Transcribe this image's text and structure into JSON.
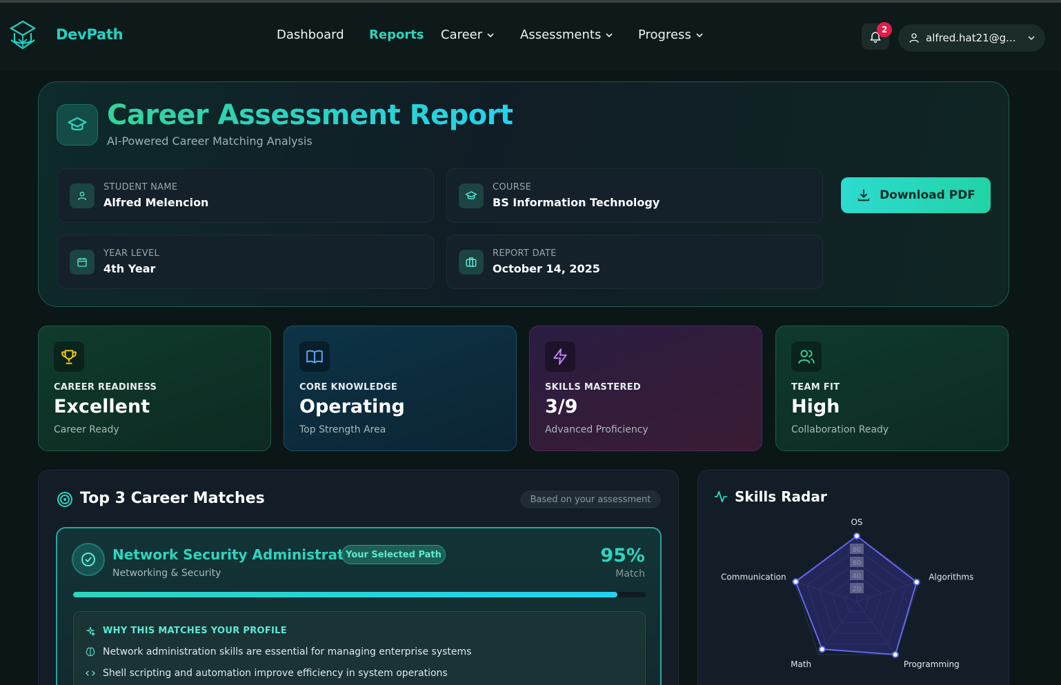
{
  "nav": {
    "brand": "DevPath",
    "links": [
      {
        "label": "Dashboard",
        "active": false,
        "dropdown": false
      },
      {
        "label": "Reports",
        "active": true,
        "dropdown": false
      },
      {
        "label": "Career",
        "active": false,
        "dropdown": true
      },
      {
        "label": "Assessments",
        "active": false,
        "dropdown": true
      },
      {
        "label": "Progress",
        "active": false,
        "dropdown": true
      }
    ],
    "notification_count": "2",
    "user_email": "alfred.hat21@g..."
  },
  "report": {
    "title": "Career Assessment Report",
    "subtitle": "AI-Powered Career Matching Analysis",
    "student_label": "STUDENT NAME",
    "student_value": "Alfred Melencion",
    "course_label": "COURSE",
    "course_value": "BS Information Technology",
    "year_label": "YEAR LEVEL",
    "year_value": "4th Year",
    "date_label": "REPORT DATE",
    "date_value": "October 14, 2025",
    "download_label": "Download PDF"
  },
  "stats": [
    {
      "label": "CAREER READINESS",
      "value": "Excellent",
      "desc": "Career Ready",
      "icon": "trophy-icon"
    },
    {
      "label": "CORE KNOWLEDGE",
      "value": "Operating",
      "desc": "Top Strength Area",
      "icon": "book-icon"
    },
    {
      "label": "SKILLS MASTERED",
      "value": "3/9",
      "desc": "Advanced Proficiency",
      "icon": "lightning-icon"
    },
    {
      "label": "TEAM FIT",
      "value": "High",
      "desc": "Collaboration Ready",
      "icon": "users-icon"
    }
  ],
  "matches": {
    "title": "Top 3 Career Matches",
    "chip": "Based on your assessment",
    "top": {
      "title": "Network Security Administrator",
      "badge": "Your Selected Path",
      "category": "Networking & Security",
      "percent": "95%",
      "percent_label": "Match",
      "progress": 0.95,
      "why_title": "WHY THIS MATCHES YOUR PROFILE",
      "reasons": [
        {
          "icon": "brain-icon",
          "text": "Network administration skills are essential for managing enterprise systems"
        },
        {
          "icon": "code-icon",
          "text": "Shell scripting and automation improve efficiency in system operations"
        }
      ]
    }
  },
  "radar": {
    "title": "Skills Radar",
    "axes": [
      "OS",
      "Algorithms",
      "Programming",
      "Math",
      "Communication"
    ],
    "ticks": [
      "20",
      "40",
      "60",
      "80"
    ],
    "colors": {
      "stroke": "#6366f1",
      "fill": "#312e81",
      "grid": "#2a3550"
    }
  },
  "chart_data": {
    "type": "radar",
    "title": "Skills Radar",
    "axes": [
      "OS",
      "Algorithms",
      "Programming",
      "Math",
      "Communication"
    ],
    "range": [
      0,
      100
    ],
    "ticks": [
      20,
      40,
      60,
      80
    ],
    "series": [
      {
        "values": [
          100,
          96,
          100,
          90,
          98
        ]
      }
    ]
  }
}
